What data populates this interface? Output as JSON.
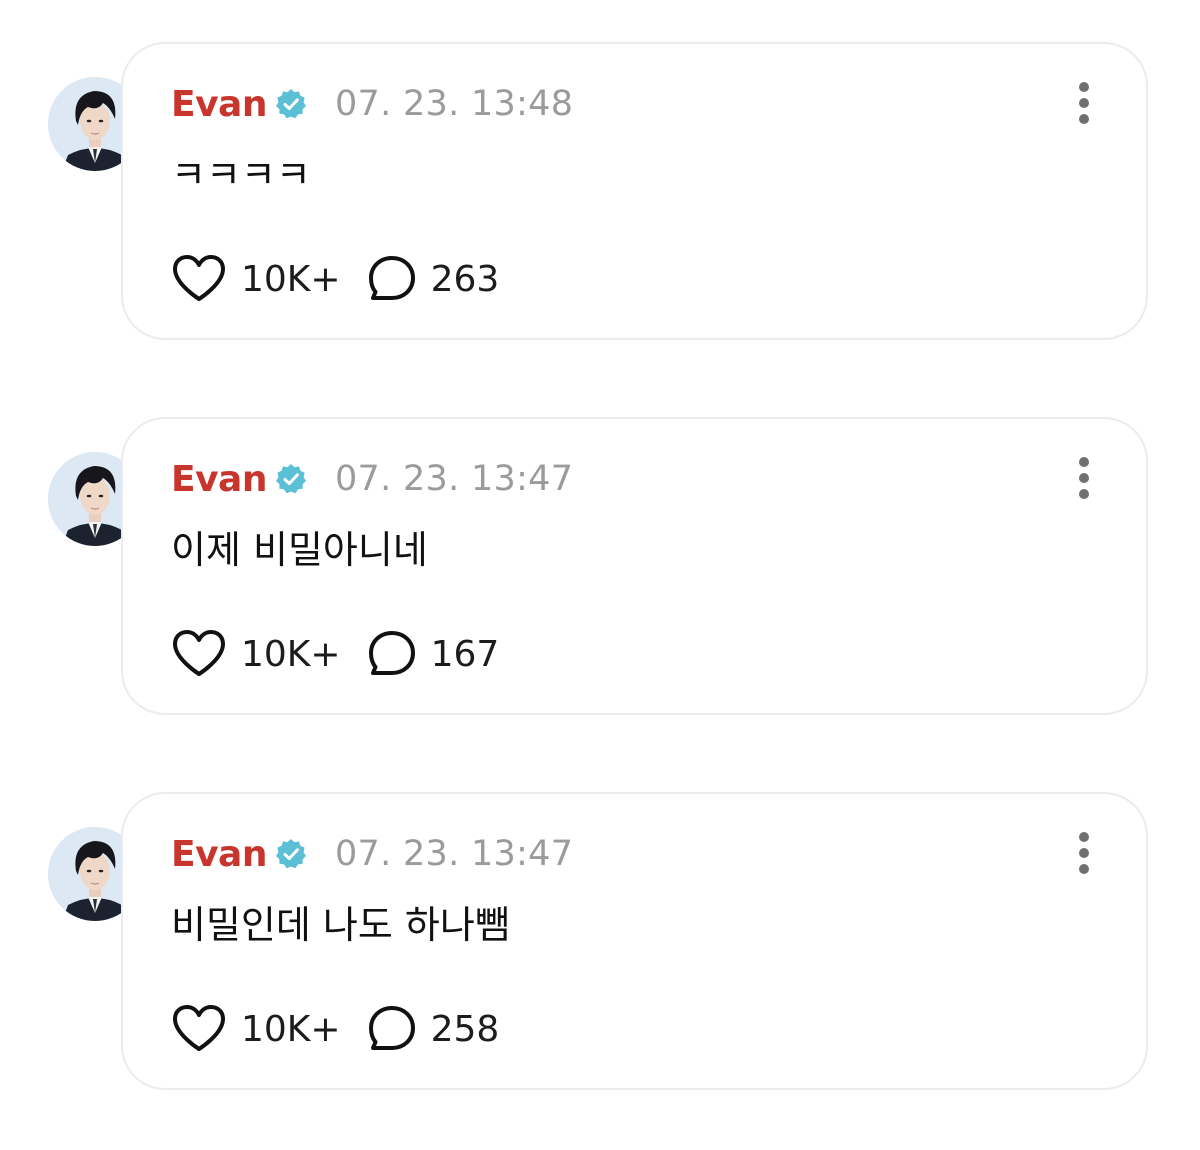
{
  "colors": {
    "author": "#c8352c",
    "verified_badge": "#5bbfd6",
    "timestamp": "#9b9b9b",
    "card_border": "#ebebf0"
  },
  "icons": {
    "verified": "verified-badge-icon",
    "like": "heart-icon",
    "comment": "speech-bubble-icon",
    "more": "vertical-ellipsis-icon"
  },
  "posts": [
    {
      "author": "Evan",
      "timestamp": "07. 23. 13:48",
      "text": "ㅋㅋㅋㅋ",
      "likes": "10K+",
      "comments": "263"
    },
    {
      "author": "Evan",
      "timestamp": "07. 23. 13:47",
      "text": "이제 비밀아니네",
      "likes": "10K+",
      "comments": "167"
    },
    {
      "author": "Evan",
      "timestamp": "07. 23. 13:47",
      "text": "비밀인데 나도 하나뺌",
      "likes": "10K+",
      "comments": "258"
    }
  ]
}
